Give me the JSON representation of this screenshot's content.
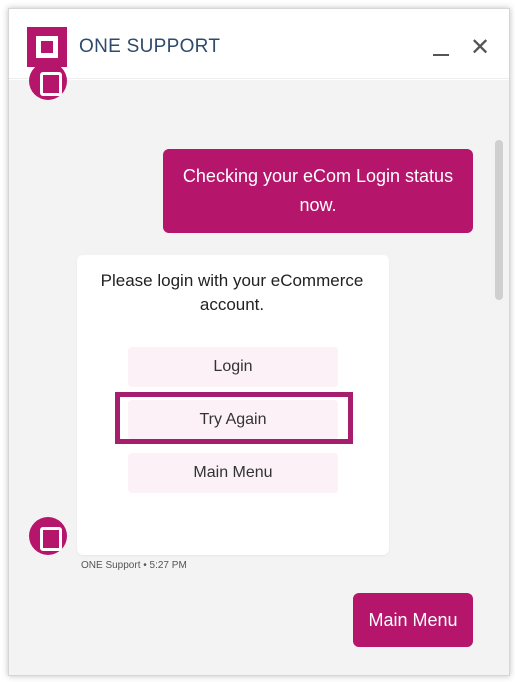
{
  "header": {
    "title": "ONE SUPPORT",
    "minimize_icon": "minimize-icon",
    "close_symbol": "✕"
  },
  "messages": {
    "user_message_1": "Checking your eCom Login status now.",
    "bot_card_text": "Please login with your eCommerce account.",
    "options": [
      "Login",
      "Try Again",
      "Main Menu"
    ],
    "meta": "ONE Support • 5:27 PM",
    "user_message_2": "Main Menu"
  },
  "colors": {
    "brand": "#b5166b",
    "option_bg": "#fcf1f6",
    "chat_bg": "#f3f3f3",
    "title_text": "#2e4b6b"
  }
}
